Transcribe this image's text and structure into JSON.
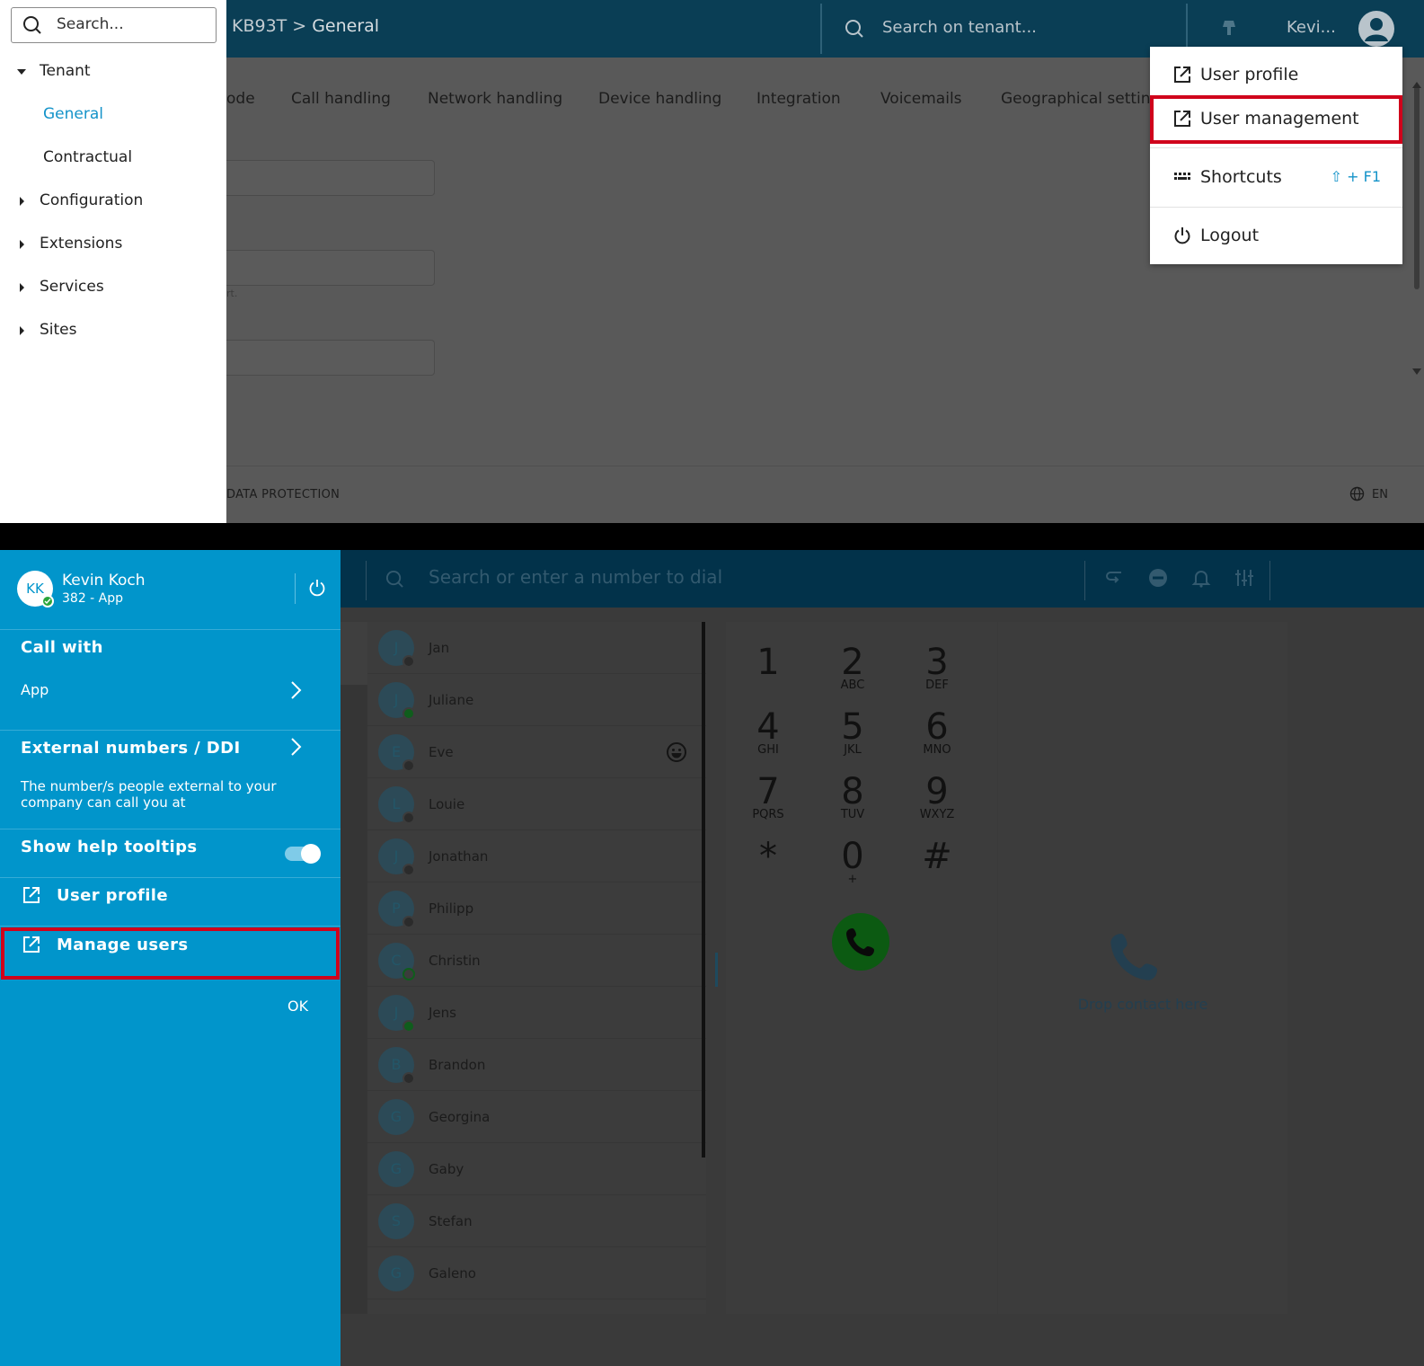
{
  "top": {
    "sidebar": {
      "search_placeholder": "Search...",
      "tree": [
        {
          "label": "Tenant",
          "expanded": true
        },
        {
          "label": "General",
          "child": true,
          "active": true
        },
        {
          "label": "Contractual",
          "child": true
        },
        {
          "label": "Configuration"
        },
        {
          "label": "Extensions"
        },
        {
          "label": "Services"
        },
        {
          "label": "Sites"
        }
      ]
    },
    "header": {
      "tenant": "KB93T",
      "separator": ">",
      "current": "General",
      "search_placeholder": "Search on tenant...",
      "user": "Kevi..."
    },
    "tabs": [
      "ode",
      "Call handling",
      "Network handling",
      "Device handling",
      "Integration",
      "Voicemails",
      "Geographical setting"
    ],
    "hint": "rt.",
    "footer": {
      "data_protection": "DATA PROTECTION",
      "language": "EN"
    },
    "user_menu": {
      "items": [
        {
          "label": "User profile",
          "icon": "external-link-icon"
        },
        {
          "label": "User management",
          "icon": "external-link-icon",
          "highlighted": true
        },
        {
          "label": "Shortcuts",
          "icon": "keyboard-icon",
          "shortcut": "⇧ + F1"
        },
        {
          "label": "Logout",
          "icon": "power-icon"
        }
      ]
    }
  },
  "bottom": {
    "user": {
      "initials": "KK",
      "name": "Kevin Koch",
      "sub": "382 - App",
      "status": "online"
    },
    "call_with": {
      "title": "Call with",
      "value": "App"
    },
    "external": {
      "title": "External numbers / DDI",
      "description": "The number/s people external to your company can call you at"
    },
    "tooltips": {
      "label": "Show help tooltips",
      "enabled": true
    },
    "user_profile": "User profile",
    "manage_users": "Manage users",
    "ok": "OK",
    "dial_placeholder": "Search or enter a number to dial",
    "contacts": [
      {
        "initial": "J",
        "name": "Jan",
        "status": "off"
      },
      {
        "initial": "J",
        "name": "Juliane",
        "status": "on"
      },
      {
        "initial": "E",
        "name": "Eve",
        "status": "off",
        "emoji": true
      },
      {
        "initial": "L",
        "name": "Louie",
        "status": "off"
      },
      {
        "initial": "J",
        "name": "Jonathan",
        "status": "off"
      },
      {
        "initial": "P",
        "name": "Philipp",
        "status": "off"
      },
      {
        "initial": "C",
        "name": "Christin",
        "status": "ring"
      },
      {
        "initial": "J",
        "name": "Jens",
        "status": "on"
      },
      {
        "initial": "B",
        "name": "Brandon",
        "status": "off"
      },
      {
        "initial": "G",
        "name": "Georgina",
        "status": "none"
      },
      {
        "initial": "G",
        "name": "Gaby",
        "status": "none"
      },
      {
        "initial": "S",
        "name": "Stefan",
        "status": "none"
      },
      {
        "initial": "G",
        "name": "Galeno",
        "status": "none"
      }
    ],
    "keypad": [
      {
        "d": "1",
        "l": ""
      },
      {
        "d": "2",
        "l": "ABC"
      },
      {
        "d": "3",
        "l": "DEF"
      },
      {
        "d": "4",
        "l": "GHI"
      },
      {
        "d": "5",
        "l": "JKL"
      },
      {
        "d": "6",
        "l": "MNO"
      },
      {
        "d": "7",
        "l": "PQRS"
      },
      {
        "d": "8",
        "l": "TUV"
      },
      {
        "d": "9",
        "l": "WXYZ"
      },
      {
        "d": "*",
        "l": ""
      },
      {
        "d": "0",
        "l": "+"
      },
      {
        "d": "#",
        "l": ""
      }
    ],
    "drop_text": "Drop contact here"
  }
}
